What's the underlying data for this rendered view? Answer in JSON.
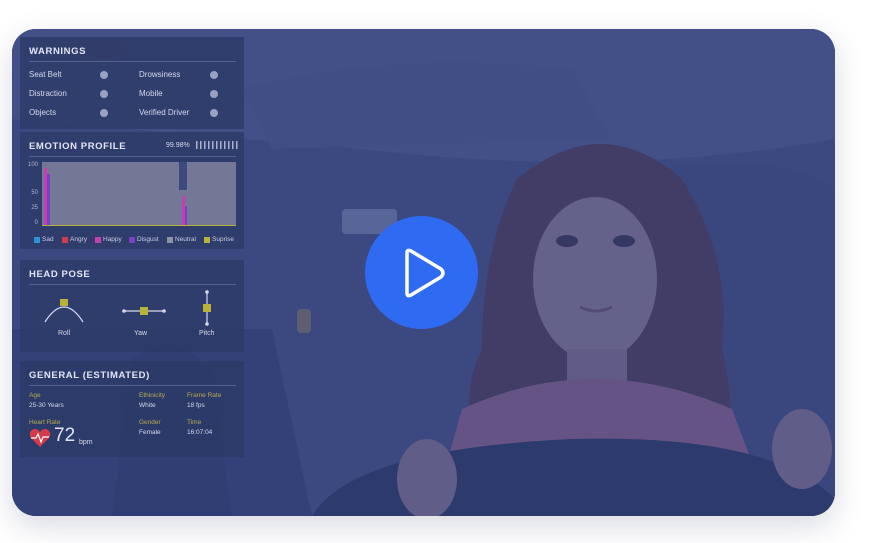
{
  "warnings": {
    "title": "WARNINGS",
    "items": [
      "Seat Belt",
      "Drowsiness",
      "Distraction",
      "Mobile",
      "Objects",
      "Verified Driver"
    ]
  },
  "emotion": {
    "title": "EMOTION PROFILE",
    "confidence": "99.98%",
    "ticks": [
      "100",
      "50",
      "25",
      "0"
    ],
    "legend": [
      {
        "label": "Sad",
        "color": "#2f8fd6"
      },
      {
        "label": "Angry",
        "color": "#d23b4a"
      },
      {
        "label": "Happy",
        "color": "#c63fb0"
      },
      {
        "label": "Disgust",
        "color": "#7a3fc2"
      },
      {
        "label": "Neutral",
        "color": "#8f92a8"
      },
      {
        "label": "Suprise",
        "color": "#b7b338"
      }
    ]
  },
  "head_pose": {
    "title": "HEAD POSE",
    "roll": "Roll",
    "yaw": "Yaw",
    "pitch": "Pitch"
  },
  "general": {
    "title": "GENERAL (ESTIMATED)",
    "age_label": "Age",
    "age": "25-30 Years",
    "ethnicity_label": "Ethinicity",
    "ethnicity": "White",
    "frame_rate_label": "Frame Rate",
    "frame_rate": "18 fps",
    "heart_rate_label": "Heart Rate",
    "heart_rate": "72",
    "heart_unit": "bpm",
    "gender_label": "Gender",
    "gender": "Female",
    "time_label": "Time",
    "time": "16:07:04"
  }
}
